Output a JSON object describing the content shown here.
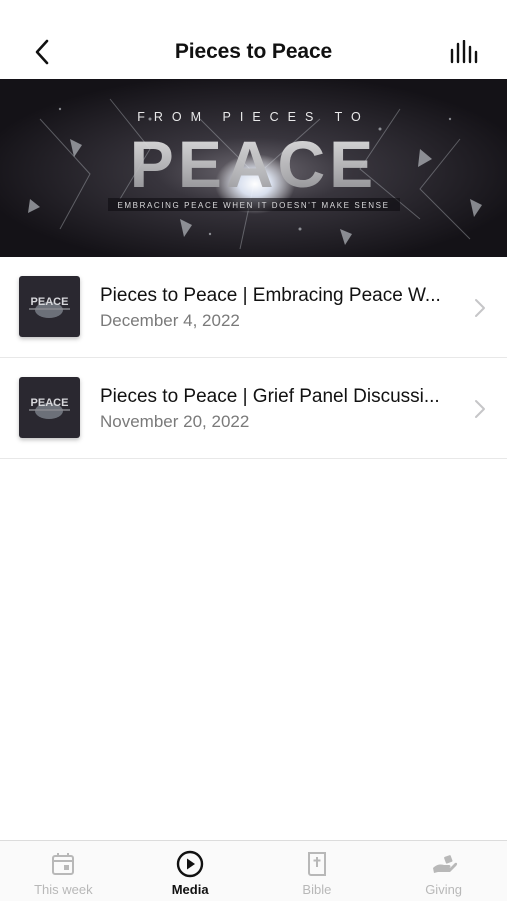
{
  "header": {
    "title": "Pieces to Peace",
    "back_icon": "chevron-left-icon",
    "audio_icon": "audio-bars-icon"
  },
  "banner": {
    "top_text": "FROM PIECES TO",
    "main_text": "PEACE",
    "tagline": "EMBRACING PEACE WHEN IT DOESN'T MAKE SENSE"
  },
  "items": [
    {
      "title": "Pieces to Peace | Embracing Peace W...",
      "date": "December 4, 2022",
      "thumb_text": "PEACE"
    },
    {
      "title": "Pieces to Peace | Grief Panel Discussi...",
      "date": "November 20, 2022",
      "thumb_text": "PEACE"
    }
  ],
  "tabs": [
    {
      "label": "This week",
      "icon": "calendar-icon",
      "active": false
    },
    {
      "label": "Media",
      "icon": "play-circle-icon",
      "active": true
    },
    {
      "label": "Bible",
      "icon": "bible-icon",
      "active": false
    },
    {
      "label": "Giving",
      "icon": "giving-hand-icon",
      "active": false
    }
  ],
  "colors": {
    "accent": "#111111",
    "inactive_tab": "#b8b8b8",
    "secondary_text": "#7a7a7a",
    "banner_bg": "#1d1b22"
  }
}
